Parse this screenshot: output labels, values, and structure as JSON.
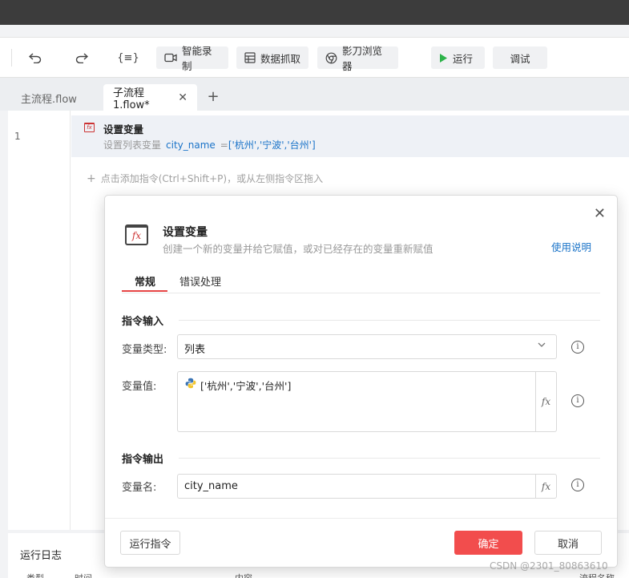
{
  "toolbar": {
    "record_label": "智能录制",
    "capture_label": "数据抓取",
    "browser_label": "影刀浏览器",
    "run_label": "运行",
    "debug_label": "调试"
  },
  "tabs": [
    {
      "label": "主流程.flow"
    },
    {
      "label": "子流程1.flow*"
    }
  ],
  "editor": {
    "line_number": "1",
    "command": {
      "title": "设置变量",
      "desc_prefix": "设置列表变量",
      "var_name": "city_name",
      "eq": "=",
      "value": "['杭州','宁波','台州']"
    },
    "add_hint": "点击添加指令(Ctrl+Shift+P)，或从左侧指令区拖入"
  },
  "log": {
    "title": "运行日志",
    "columns": [
      "类型",
      "时间",
      "内容",
      "流程名称"
    ]
  },
  "dialog": {
    "title": "设置变量",
    "subtitle": "创建一个新的变量并给它赋值，或对已经存在的变量重新赋值",
    "help_link": "使用说明",
    "tabs": [
      "常规",
      "错误处理"
    ],
    "input_section": "指令输入",
    "var_type_label": "变量类型:",
    "var_type_value": "列表",
    "var_value_label": "变量值:",
    "var_value": "['杭州','宁波','台州']",
    "output_section": "指令输出",
    "var_name_label": "变量名:",
    "var_name_value": "city_name",
    "run_cmd_label": "运行指令",
    "ok_label": "确定",
    "cancel_label": "取消"
  },
  "watermark": "CSDN @2301_80863610",
  "colors": {
    "accent_red": "#f24d4d",
    "link_blue": "#1a73c8",
    "run_green": "#2db34a"
  }
}
